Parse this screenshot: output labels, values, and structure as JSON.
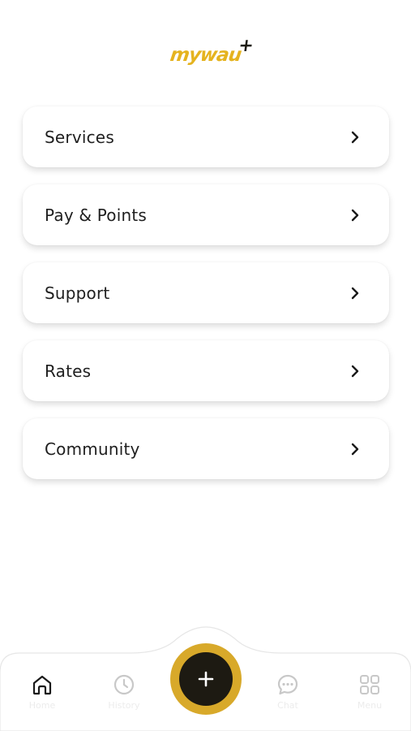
{
  "app": {
    "logo_text": "mywau",
    "logo_plus": "+"
  },
  "menu": {
    "items": [
      {
        "label": "Services",
        "icon": "chevron-right-icon"
      },
      {
        "label": "Pay & Points",
        "icon": "chevron-right-icon"
      },
      {
        "label": "Support",
        "icon": "chevron-right-icon"
      },
      {
        "label": "Rates",
        "icon": "chevron-right-icon"
      },
      {
        "label": "Community",
        "icon": "chevron-right-icon"
      }
    ]
  },
  "bottom_nav": {
    "items": [
      {
        "label": "Home",
        "icon": "home-icon",
        "active": true
      },
      {
        "label": "History",
        "icon": "clock-icon",
        "active": false
      },
      {
        "label": "Chat",
        "icon": "chat-bubble-icon",
        "active": false
      },
      {
        "label": "Menu",
        "icon": "grid-icon",
        "active": false
      }
    ],
    "fab": {
      "icon": "plus-icon"
    }
  },
  "colors": {
    "brand_gold": "#e5b31f",
    "fab_ring": "#d8a92a",
    "fab_center": "#1d1a12",
    "text_dark": "#1f1f1f",
    "inactive_icon": "#c8c8c8"
  }
}
